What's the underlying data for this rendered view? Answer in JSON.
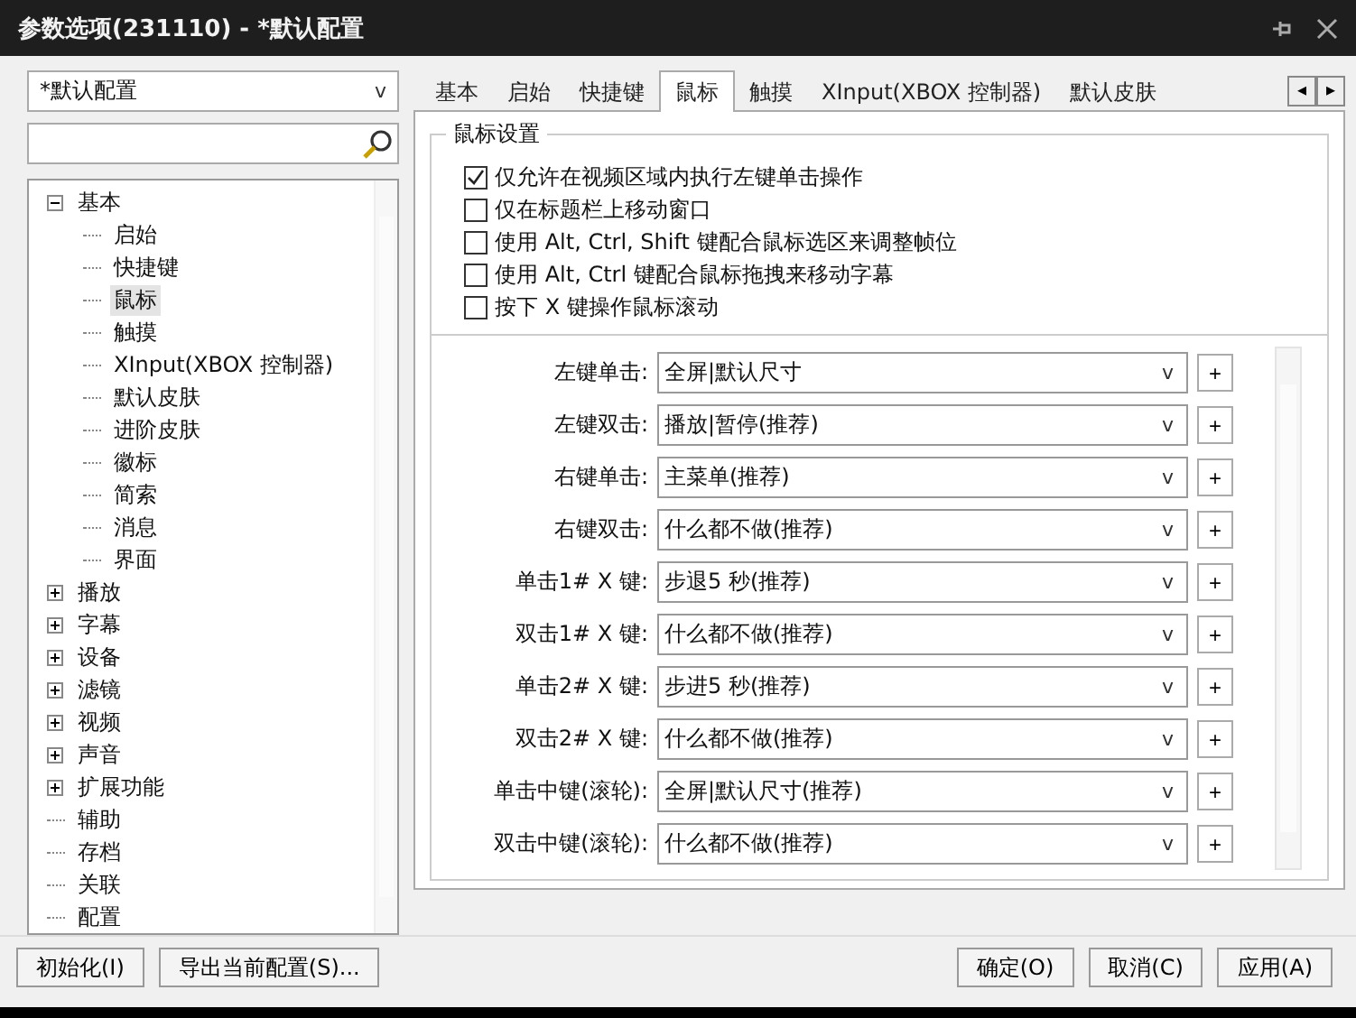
{
  "window": {
    "title": "参数选项(231110) - *默认配置"
  },
  "profile_dropdown": {
    "value": "*默认配置",
    "arrow": "v"
  },
  "tree": [
    {
      "label": "基本",
      "kind": "group",
      "expanded": true,
      "selected": false,
      "children": [
        {
          "label": "启始",
          "selected": false
        },
        {
          "label": "快捷键",
          "selected": false
        },
        {
          "label": "鼠标",
          "selected": true
        },
        {
          "label": "触摸",
          "selected": false
        },
        {
          "label": "XInput(XBOX 控制器)",
          "selected": false
        },
        {
          "label": "默认皮肤",
          "selected": false
        },
        {
          "label": "进阶皮肤",
          "selected": false
        },
        {
          "label": "徽标",
          "selected": false
        },
        {
          "label": "简索",
          "selected": false
        },
        {
          "label": "消息",
          "selected": false
        },
        {
          "label": "界面",
          "selected": false
        }
      ]
    },
    {
      "label": "播放",
      "kind": "group",
      "expanded": false,
      "selected": false
    },
    {
      "label": "字幕",
      "kind": "group",
      "expanded": false,
      "selected": false
    },
    {
      "label": "设备",
      "kind": "group",
      "expanded": false,
      "selected": false
    },
    {
      "label": "滤镜",
      "kind": "group",
      "expanded": false,
      "selected": false
    },
    {
      "label": "视频",
      "kind": "group",
      "expanded": false,
      "selected": false
    },
    {
      "label": "声音",
      "kind": "group",
      "expanded": false,
      "selected": false
    },
    {
      "label": "扩展功能",
      "kind": "group",
      "expanded": false,
      "selected": false
    },
    {
      "label": "辅助",
      "kind": "leaf",
      "selected": false
    },
    {
      "label": "存档",
      "kind": "leaf",
      "selected": false
    },
    {
      "label": "关联",
      "kind": "leaf",
      "selected": false
    },
    {
      "label": "配置",
      "kind": "leaf",
      "selected": false
    }
  ],
  "left_buttons": [
    "初始化(I)",
    "导出当前配置(S)..."
  ],
  "tabs": [
    {
      "label": "基本",
      "selected": false
    },
    {
      "label": "启始",
      "selected": false
    },
    {
      "label": "快捷键",
      "selected": false
    },
    {
      "label": "鼠标",
      "selected": true
    },
    {
      "label": "触摸",
      "selected": false
    },
    {
      "label": "XInput(XBOX 控制器)",
      "selected": false
    },
    {
      "label": "默认皮肤",
      "selected": false
    }
  ],
  "tab_scroll": [
    "◂",
    "▸"
  ],
  "group": {
    "title": "鼠标设置",
    "checkboxes": [
      {
        "label": "仅允许在视频区域内执行左键单击操作",
        "checked": true
      },
      {
        "label": "仅在标题栏上移动窗口",
        "checked": false
      },
      {
        "label": "使用 Alt, Ctrl, Shift 键配合鼠标选区来调整帧位",
        "checked": false
      },
      {
        "label": "使用 Alt, Ctrl 键配合鼠标拖拽来移动字幕",
        "checked": false
      },
      {
        "label": "按下 X 键操作鼠标滚动",
        "checked": false
      }
    ]
  },
  "actions": [
    {
      "label": "左键单击:",
      "value": "全屏|默认尺寸",
      "arrow": "v",
      "add": "+"
    },
    {
      "label": "左键双击:",
      "value": "播放|暂停(推荐)",
      "arrow": "v",
      "add": "+"
    },
    {
      "label": "右键单击:",
      "value": "主菜单(推荐)",
      "arrow": "v",
      "add": "+"
    },
    {
      "label": "右键双击:",
      "value": "什么都不做(推荐)",
      "arrow": "v",
      "add": "+"
    },
    {
      "label": "单击1# X 键:",
      "value": "步退5 秒(推荐)",
      "arrow": "v",
      "add": "+"
    },
    {
      "label": "双击1# X 键:",
      "value": "什么都不做(推荐)",
      "arrow": "v",
      "add": "+"
    },
    {
      "label": "单击2# X 键:",
      "value": "步进5 秒(推荐)",
      "arrow": "v",
      "add": "+"
    },
    {
      "label": "双击2# X 键:",
      "value": "什么都不做(推荐)",
      "arrow": "v",
      "add": "+"
    },
    {
      "label": "单击中键(滚轮):",
      "value": "全屏|默认尺寸(推荐)",
      "arrow": "v",
      "add": "+"
    },
    {
      "label": "双击中键(滚轮):",
      "value": "什么都不做(推荐)",
      "arrow": "v",
      "add": "+"
    }
  ],
  "bottom_buttons": [
    "确定(O)",
    "取消(C)",
    "应用(A)"
  ]
}
